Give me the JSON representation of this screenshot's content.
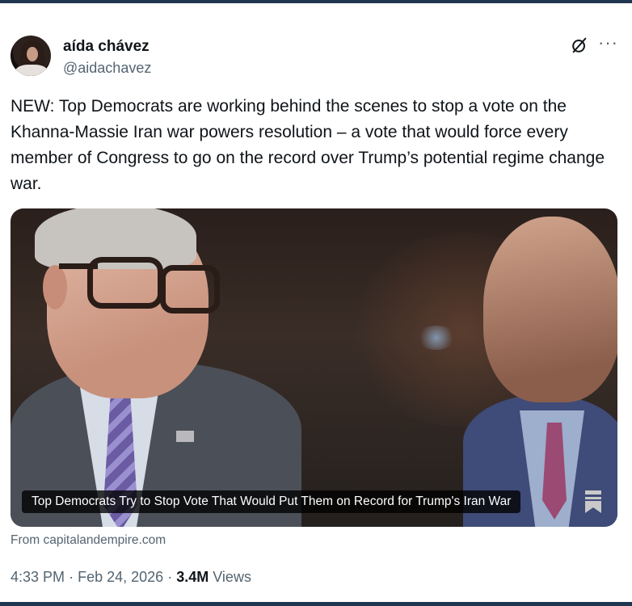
{
  "author": {
    "display_name": "aída chávez",
    "handle": "@aidachavez"
  },
  "icons": {
    "grok": "grok-icon",
    "more": "more-icon",
    "bookmark": "bookmark-icon",
    "more_glyph": "···"
  },
  "tweet": {
    "text": "NEW: Top Democrats are working behind the scenes to stop a vote on the Khanna-Massie Iran war powers resolution – a vote that would force every member of Congress to go on the record over Trump’s potential regime change war."
  },
  "card": {
    "caption": "Top Democrats Try to Stop Vote That Would Put Them on Record for Trump's Iran War",
    "source": "From capitalandempire.com"
  },
  "meta": {
    "time": "4:33 PM",
    "separator": "·",
    "date": "Feb 24, 2026",
    "views_count": "3.4M",
    "views_label": "Views"
  },
  "colors": {
    "text": "#0f1419",
    "secondary": "#536471",
    "frame": "#1f3550"
  }
}
